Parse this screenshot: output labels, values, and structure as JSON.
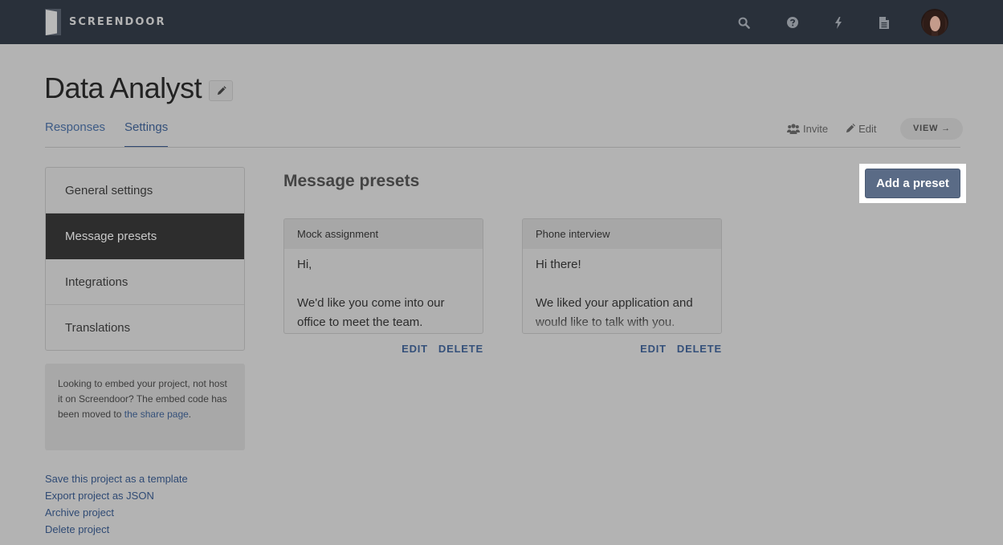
{
  "app": {
    "brand": "SCREENDOOR",
    "nav_icons": [
      "search-icon",
      "help-icon",
      "bolt-icon",
      "document-icon"
    ],
    "avatar_alt": "user-avatar"
  },
  "project": {
    "title": "Data Analyst",
    "tabs": [
      {
        "label": "Responses",
        "active": false
      },
      {
        "label": "Settings",
        "active": true
      }
    ],
    "actions": {
      "invite": "Invite",
      "edit": "Edit",
      "view": "VIEW →"
    }
  },
  "sidebar": {
    "items": [
      {
        "label": "General settings",
        "active": false
      },
      {
        "label": "Message presets",
        "active": true
      },
      {
        "label": "Integrations",
        "active": false
      },
      {
        "label": "Translations",
        "active": false
      }
    ],
    "embed_note": {
      "text": "Looking to embed your project, not host it on Screendoor? The embed code has been moved to ",
      "link": "the share page",
      "suffix": "."
    },
    "project_links": [
      "Save this project as a template",
      "Export project as JSON",
      "Archive project",
      "Delete project"
    ]
  },
  "main": {
    "section_title": "Message presets",
    "add_button": "Add a preset",
    "presets": [
      {
        "name": "Mock assignment",
        "lines": [
          "Hi,",
          "",
          "We'd like you come into our",
          "office to meet the team."
        ],
        "edit": "EDIT",
        "delete": "DELETE"
      },
      {
        "name": "Phone interview",
        "lines": [
          "Hi there!",
          "",
          "We liked your application and",
          "would like to talk with you."
        ],
        "edit": "EDIT",
        "delete": "DELETE"
      }
    ]
  },
  "colors": {
    "topbar": "#29303a",
    "overlay_bg": "#b3b3b3",
    "link": "#34507a",
    "primary_button": "#5a6b86",
    "active_menu": "#2d2d2d"
  }
}
